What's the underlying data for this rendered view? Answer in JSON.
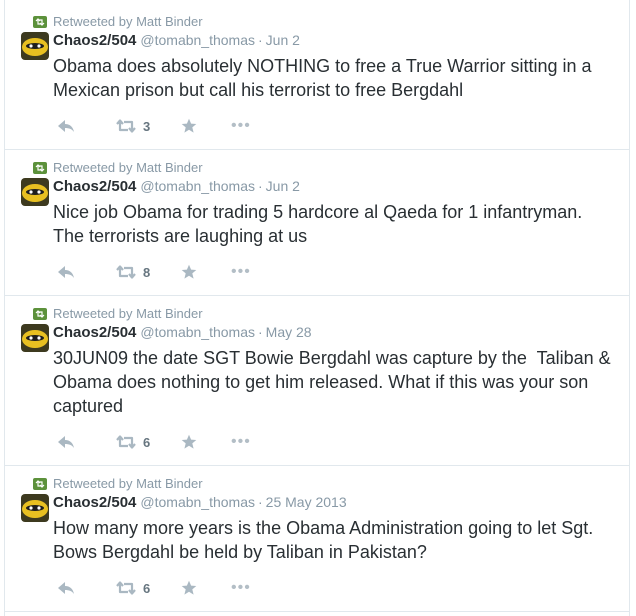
{
  "tweets": [
    {
      "retweeted_by": "Retweeted by Matt Binder",
      "name": "Chaos2/504",
      "handle": "@tomabn_thomas",
      "separator": "·",
      "time": "Jun 2",
      "text": "Obama does absolutely NOTHING to free a True Warrior sitting in a Mexican prison but call his terrorist to free Bergdahl",
      "retweet_count": "3",
      "more_label": "•••"
    },
    {
      "retweeted_by": "Retweeted by Matt Binder",
      "name": "Chaos2/504",
      "handle": "@tomabn_thomas",
      "separator": "·",
      "time": "Jun 2",
      "text": "Nice job Obama for trading 5 hardcore al Qaeda for 1 infantryman. The terrorists are laughing at us",
      "retweet_count": "8",
      "more_label": "•••"
    },
    {
      "retweeted_by": "Retweeted by Matt Binder",
      "name": "Chaos2/504",
      "handle": "@tomabn_thomas",
      "separator": "·",
      "time": "May 28",
      "text": "30JUN09 the date SGT Bowie Bergdahl was capture by the  Taliban & Obama does nothing to get him released. What if this was your son captured",
      "retweet_count": "6",
      "more_label": "•••"
    },
    {
      "retweeted_by": "Retweeted by Matt Binder",
      "name": "Chaos2/504",
      "handle": "@tomabn_thomas",
      "separator": "·",
      "time": "25 May 2013",
      "text": "How many more years is the Obama Administration going to let Sgt. Bows Bergdahl be held by Taliban in Pakistan?",
      "retweet_count": "6",
      "more_label": "•••"
    }
  ],
  "colors": {
    "text": "#292f33",
    "muted": "#8899a6",
    "action_icon": "#aab8c2",
    "retweet_badge": "#5c913b",
    "border": "#e1e8ed"
  },
  "icons": [
    "retweet-badge-icon",
    "reply-icon",
    "retweet-icon",
    "favorite-star-icon",
    "more-icon"
  ]
}
